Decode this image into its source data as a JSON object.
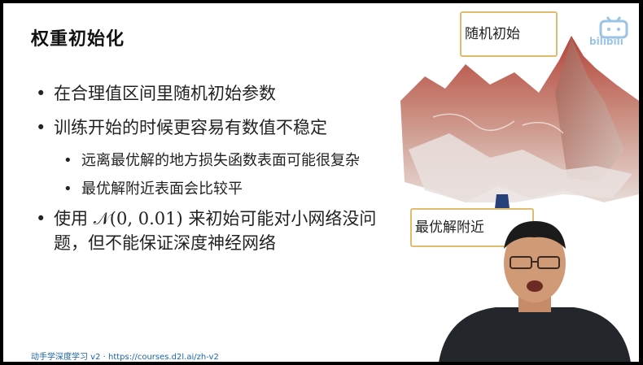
{
  "slide": {
    "title": "权重初始化",
    "bullets": [
      "在合理值区间里随机初始参数",
      "训练开始的时候更容易有数值不稳定"
    ],
    "sub_bullets": [
      "远离最优解的地方损失函数表面可能很复杂",
      "最优解附近表面会比较平"
    ],
    "bullet3_pre": "使用",
    "bullet3_math": "𝒩(0, 0.01)",
    "bullet3_post": "来初始可能对小网络没问题，但不能保证深度神经网络",
    "footer_text": "动手学深度学习 v2 · ",
    "footer_link": "https://courses.d2l.ai/zh-v2"
  },
  "figure": {
    "callout_top": "随机初始",
    "callout_bottom": "最优解附近"
  },
  "overlay": {
    "logo_icon": "bilibili-logo-icon",
    "logo_text": "bilibili"
  },
  "colors": {
    "footer_link": "#1a63a8",
    "callout_border": "#e0bb6e",
    "surface_peak": "#b5433a",
    "surface_base": "#d9a99a"
  }
}
